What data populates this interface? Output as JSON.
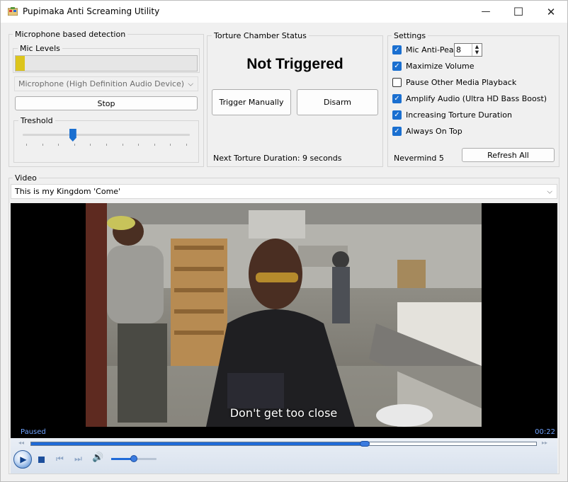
{
  "window": {
    "title": "Pupimaka Anti Screaming Utility",
    "minimize_glyph": "—",
    "maximize_glyph": "☐",
    "close_glyph": "✕"
  },
  "detection": {
    "group_label": "Microphone based detection",
    "mic_levels_label": "Mic Levels",
    "mic_level_fraction": 0.05,
    "mic_level_color": "#dcc51c",
    "device_placeholder": "Microphone (High Definition Audio Device)",
    "stop_label": "Stop",
    "threshold_label": "Treshold",
    "threshold_fraction": 0.3
  },
  "status": {
    "group_label": "Torture Chamber Status",
    "state_text": "Not Triggered",
    "trigger_label": "Trigger Manually",
    "disarm_label": "Disarm",
    "next_duration_text": "Next Torture Duration: 9 seconds"
  },
  "settings": {
    "group_label": "Settings",
    "items": [
      {
        "label": "Mic Anti-Peak",
        "checked": true
      },
      {
        "label": "Maximize Volume",
        "checked": true
      },
      {
        "label": "Pause Other Media Playback",
        "checked": false
      },
      {
        "label": "Amplify Audio (Ultra HD Bass Boost)",
        "checked": true
      },
      {
        "label": "Increasing Torture Duration",
        "checked": true
      },
      {
        "label": "Always On Top",
        "checked": true
      }
    ],
    "anti_peak_value": "8",
    "footer_text": "Nevermind 5",
    "refresh_label": "Refresh All"
  },
  "video": {
    "group_label": "Video",
    "selected": "This is my Kingdom 'Come'",
    "subtitle": "Don't get too close",
    "status": "Paused",
    "time": "00:22",
    "progress_fraction": 0.66,
    "volume_fraction": 0.5,
    "accent_color": "#1f6ad8"
  }
}
